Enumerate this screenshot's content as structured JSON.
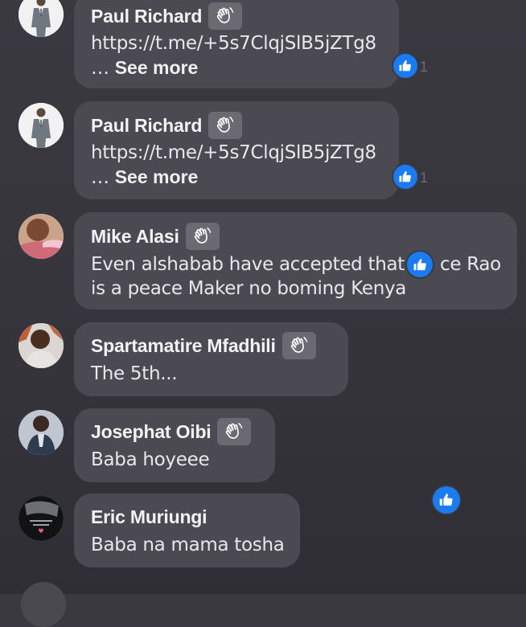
{
  "comments": [
    {
      "author": "Paul Richard",
      "line1": "https://t.me/+5s7ClqjSlB5jZTg8",
      "ellipsis": "… ",
      "see_more": "See more",
      "reaction_count": "1",
      "avatar": "suit-man-avatar"
    },
    {
      "author": "Paul Richard",
      "line1": "https://t.me/+5s7ClqjSlB5jZTg8",
      "ellipsis": "… ",
      "see_more": "See more",
      "reaction_count": "1",
      "avatar": "suit-man-avatar"
    },
    {
      "author": "Mike Alasi",
      "line1": "Even alshabab have accepted that",
      "line1b": "ce Rao",
      "line2": "is a peace Maker  no boming Kenya",
      "avatar": "person-avatar"
    },
    {
      "author": "Spartamatire Mfadhili",
      "line1": "The 5th...",
      "avatar": "person-avatar"
    },
    {
      "author": "Josephat Oibi",
      "line1": "Baba hoyeee",
      "avatar": "person-avatar"
    },
    {
      "author": "Eric Muriungi",
      "line1": "Baba na mama tosha",
      "avatar": "dark-photo-avatar"
    }
  ],
  "icons": {
    "wave": "wave-hand-icon",
    "like": "thumbs-up-icon"
  },
  "colors": {
    "like_blue": "#1a7bf2",
    "bubble": "#4b4a52",
    "background": "#3a3940"
  }
}
